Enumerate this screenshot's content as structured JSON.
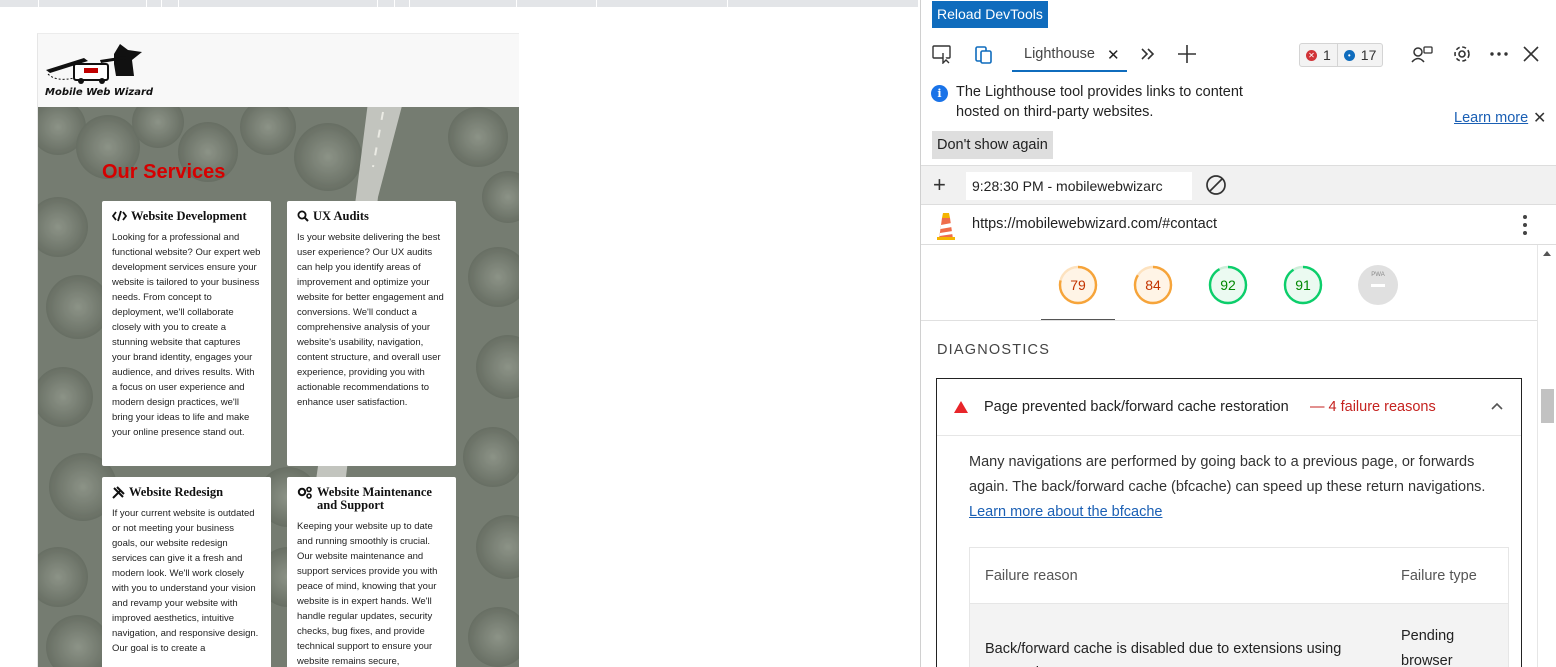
{
  "site": {
    "logo_text": "Mobile Web Wizard",
    "section_title": "Our Services",
    "cards": [
      {
        "title": "Website Development",
        "icon": "code-icon",
        "text": "Looking for a professional and functional website? Our expert web development services ensure your website is tailored to your business needs. From concept to deployment, we'll collaborate closely with you to create a stunning website that captures your brand identity, engages your audience, and drives results. With a focus on user experience and modern design practices, we'll bring your ideas to life and make your online presence stand out."
      },
      {
        "title": "UX Audits",
        "icon": "search-icon",
        "text": "Is your website delivering the best user experience? Our UX audits can help you identify areas of improvement and optimize your website for better engagement and conversions. We'll conduct a comprehensive analysis of your website's usability, navigation, content structure, and overall user experience, providing you with actionable recommendations to enhance user satisfaction."
      },
      {
        "title": "Website Redesign",
        "icon": "tools-icon",
        "text": "If your current website is outdated or not meeting your business goals, our website redesign services can give it a fresh and modern look. We'll work closely with you to understand your vision and revamp your website with improved aesthetics, intuitive navigation, and responsive design. Our goal is to create a"
      },
      {
        "title": "Website Maintenance and Support",
        "icon": "gears-icon",
        "text": "Keeping your website up to date and running smoothly is crucial. Our website maintenance and support services provide you with peace of mind, knowing that your website is in expert hands. We'll handle regular updates, security checks, bug fixes, and provide technical support to ensure your website remains secure,"
      }
    ]
  },
  "devtools": {
    "reload_label": "Reload DevTools",
    "tab_label": "Lighthouse",
    "tab_close": "✕",
    "error_count": "1",
    "message_count": "17",
    "info_text": "The Lighthouse tool provides links to content hosted on third-party websites.",
    "learn_more": "Learn more",
    "dont_show": "Don't show again",
    "report_select": "9:28:30 PM - mobilewebwizarc",
    "report_url": "https://mobilewebwizard.com/#contact",
    "scores": [
      {
        "value": "79",
        "score": 0.79,
        "status": "average"
      },
      {
        "value": "84",
        "score": 0.84,
        "status": "average"
      },
      {
        "value": "92",
        "score": 0.92,
        "status": "pass"
      },
      {
        "value": "91",
        "score": 0.91,
        "status": "pass"
      },
      {
        "value": "PWA",
        "score": null,
        "status": "na"
      }
    ],
    "colors": {
      "accent": "#0f6cbd",
      "average": "#f6a43a",
      "average_text": "#c33300",
      "pass": "#0cce6b",
      "pass_text": "#008800",
      "fail": "#e8252a",
      "na": "#e0e0e0"
    },
    "diagnostics_title": "DIAGNOSTICS",
    "audit": {
      "title": "Page prevented back/forward cache restoration",
      "failure_label": "— 4 failure reasons",
      "description": "Many navigations are performed by going back to a previous page, or forwards again. The back/forward cache (bfcache) can speed up these return navigations.",
      "link": "Learn more about the bfcache",
      "table_headers": [
        "Failure reason",
        "Failure type"
      ],
      "rows": [
        {
          "reason": "Back/forward cache is disabled due to extensions using messaging API.",
          "type": "Pending browser support"
        }
      ]
    }
  }
}
